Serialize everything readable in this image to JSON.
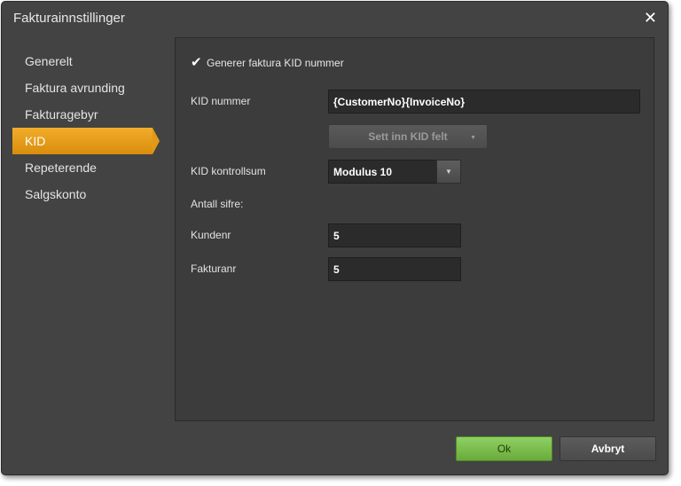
{
  "dialog": {
    "title": "Fakturainnstillinger",
    "close_glyph": "✕"
  },
  "nav": {
    "items": [
      {
        "label": "Generelt"
      },
      {
        "label": "Faktura avrunding"
      },
      {
        "label": "Fakturagebyr"
      },
      {
        "label": "KID",
        "active": true
      },
      {
        "label": "Repeterende"
      },
      {
        "label": "Salgskonto"
      }
    ]
  },
  "kid": {
    "generate_label": "Generer faktura KID nummer",
    "generate_checked": true,
    "kid_number_label": "KID nummer",
    "kid_number_value": "{CustomerNo}{InvoiceNo}",
    "insert_button_label": "Sett inn KID felt",
    "checksum_label": "KID kontrollsum",
    "checksum_value": "Modulus 10",
    "digits_label": "Antall sifre:",
    "customer_label": "Kundenr",
    "customer_value": "5",
    "invoice_label": "Fakturanr",
    "invoice_value": "5"
  },
  "footer": {
    "ok_label": "Ok",
    "cancel_label": "Avbryt"
  },
  "colors": {
    "accent": "#e89d15",
    "ok": "#7dbd4c",
    "panel": "#3c3c3c",
    "window": "#434343"
  },
  "icons": {
    "check": "checkmark-icon",
    "close": "close-icon",
    "caret": "caret-down-icon"
  }
}
